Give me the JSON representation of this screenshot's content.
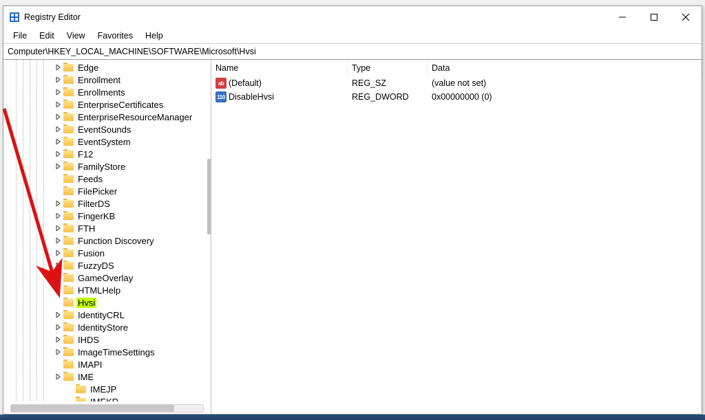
{
  "window": {
    "title": "Registry Editor"
  },
  "menubar": [
    "File",
    "Edit",
    "View",
    "Favorites",
    "Help"
  ],
  "address": "Computer\\HKEY_LOCAL_MACHINE\\SOFTWARE\\Microsoft\\Hvsi",
  "tree": {
    "nodes": [
      {
        "label": "Edge",
        "expandable": true,
        "indent": 5
      },
      {
        "label": "Enrollment",
        "expandable": true,
        "indent": 5
      },
      {
        "label": "Enrollments",
        "expandable": true,
        "indent": 5
      },
      {
        "label": "EnterpriseCertificates",
        "expandable": true,
        "indent": 5
      },
      {
        "label": "EnterpriseResourceManager",
        "expandable": true,
        "indent": 5
      },
      {
        "label": "EventSounds",
        "expandable": true,
        "indent": 5
      },
      {
        "label": "EventSystem",
        "expandable": true,
        "indent": 5
      },
      {
        "label": "F12",
        "expandable": true,
        "indent": 5
      },
      {
        "label": "FamilyStore",
        "expandable": true,
        "indent": 5
      },
      {
        "label": "Feeds",
        "expandable": false,
        "indent": 5
      },
      {
        "label": "FilePicker",
        "expandable": false,
        "indent": 5
      },
      {
        "label": "FilterDS",
        "expandable": true,
        "indent": 5
      },
      {
        "label": "FingerKB",
        "expandable": true,
        "indent": 5
      },
      {
        "label": "FTH",
        "expandable": true,
        "indent": 5
      },
      {
        "label": "Function Discovery",
        "expandable": true,
        "indent": 5
      },
      {
        "label": "Fusion",
        "expandable": true,
        "indent": 5
      },
      {
        "label": "FuzzyDS",
        "expandable": true,
        "indent": 5
      },
      {
        "label": "GameOverlay",
        "expandable": true,
        "indent": 5
      },
      {
        "label": "HTMLHelp",
        "expandable": true,
        "indent": 5
      },
      {
        "label": "Hvsi",
        "expandable": false,
        "indent": 5,
        "selected": true
      },
      {
        "label": "IdentityCRL",
        "expandable": true,
        "indent": 5
      },
      {
        "label": "IdentityStore",
        "expandable": true,
        "indent": 5
      },
      {
        "label": "IHDS",
        "expandable": true,
        "indent": 5
      },
      {
        "label": "ImageTimeSettings",
        "expandable": true,
        "indent": 5
      },
      {
        "label": "IMAPI",
        "expandable": false,
        "indent": 5
      },
      {
        "label": "IME",
        "expandable": true,
        "indent": 5
      },
      {
        "label": "IMEJP",
        "expandable": false,
        "indent": 6
      },
      {
        "label": "IMEKR",
        "expandable": false,
        "indent": 6
      }
    ]
  },
  "list": {
    "columns": {
      "name": "Name",
      "type": "Type",
      "data": "Data"
    },
    "rows": [
      {
        "icon": "sz",
        "name": "(Default)",
        "type": "REG_SZ",
        "data": "(value not set)"
      },
      {
        "icon": "dw",
        "name": "DisableHvsi",
        "type": "REG_DWORD",
        "data": "0x00000000 (0)"
      }
    ]
  },
  "icons": {
    "sz_text": "ab",
    "dw_text": "110"
  }
}
